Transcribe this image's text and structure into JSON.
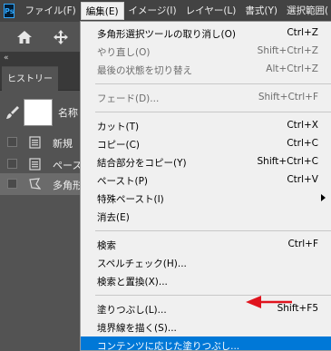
{
  "app": {
    "logo": "Ps"
  },
  "menubar": {
    "items": [
      {
        "label": "ファイル(F)"
      },
      {
        "label": "編集(E)"
      },
      {
        "label": "イメージ(I)"
      },
      {
        "label": "レイヤー(L)"
      },
      {
        "label": "書式(Y)"
      },
      {
        "label": "選択範囲("
      }
    ]
  },
  "toolbar": {
    "home_icon": "home-icon",
    "move_icon": "move-icon"
  },
  "panel": {
    "collapse_glyph": "«",
    "history_tab": "ヒストリー",
    "snapshot_name": "名称",
    "rows": [
      {
        "label": "新規"
      },
      {
        "label": "ペース"
      },
      {
        "label": "多角形"
      }
    ]
  },
  "edit_menu": {
    "groups": [
      [
        {
          "label": "多角形選択ツールの取り消し(O)",
          "shortcut": "Ctrl+Z",
          "disabled": false
        },
        {
          "label": "やり直し(O)",
          "shortcut": "Shift+Ctrl+Z",
          "disabled": true
        },
        {
          "label": "最後の状態を切り替え",
          "shortcut": "Alt+Ctrl+Z",
          "disabled": true
        }
      ],
      [
        {
          "label": "フェード(D)...",
          "shortcut": "Shift+Ctrl+F",
          "disabled": true
        }
      ],
      [
        {
          "label": "カット(T)",
          "shortcut": "Ctrl+X",
          "disabled": false
        },
        {
          "label": "コピー(C)",
          "shortcut": "Ctrl+C",
          "disabled": false
        },
        {
          "label": "結合部分をコピー(Y)",
          "shortcut": "Shift+Ctrl+C",
          "disabled": false
        },
        {
          "label": "ペースト(P)",
          "shortcut": "Ctrl+V",
          "disabled": false
        },
        {
          "label": "特殊ペースト(I)",
          "shortcut": "",
          "disabled": false,
          "submenu": true
        },
        {
          "label": "消去(E)",
          "shortcut": "",
          "disabled": false
        }
      ],
      [
        {
          "label": "検索",
          "shortcut": "Ctrl+F",
          "disabled": false
        },
        {
          "label": "スペルチェック(H)...",
          "shortcut": "",
          "disabled": false
        },
        {
          "label": "検索と置換(X)...",
          "shortcut": "",
          "disabled": false
        }
      ],
      [
        {
          "label": "塗りつぶし(L)...",
          "shortcut": "Shift+F5",
          "disabled": false
        },
        {
          "label": "境界線を描く(S)...",
          "shortcut": "",
          "disabled": false
        },
        {
          "label": "コンテンツに応じた塗りつぶし...",
          "shortcut": "",
          "disabled": false,
          "highlighted": true
        }
      ]
    ]
  },
  "annotation": {
    "arrow_color": "#e0141e"
  },
  "colors": {
    "accent": "#0078d7",
    "menubar": "#434343",
    "panel": "#535353"
  }
}
